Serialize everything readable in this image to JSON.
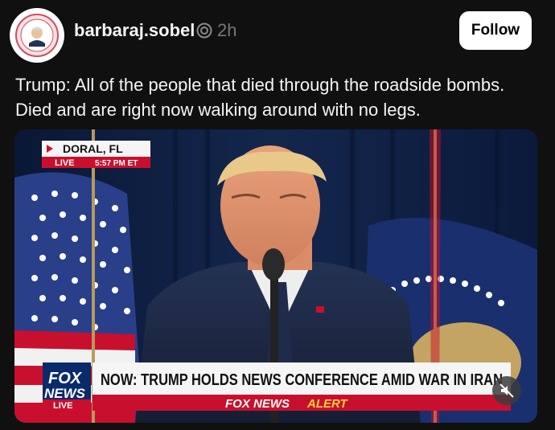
{
  "post": {
    "username": "barbaraj.sobel",
    "timestamp": "2h",
    "follow_label": "Follow",
    "text": "Trump: All of the people that died through the roadside bombs. Died and are right now walking around with no legs.",
    "avatar_text": "WILD LOVES JOE"
  },
  "video": {
    "location": "DORAL, FL",
    "live_label": "LIVE",
    "live_time": "5:57 PM ET",
    "headline": "NOW: TRUMP HOLDS NEWS CONFERENCE AMID WAR IN IRAN",
    "alert_prefix": "FOX NEWS",
    "alert_word": "ALERT",
    "logo_top": "FOX",
    "logo_bottom": "NEWS",
    "logo_live": "LIVE"
  },
  "icons": {
    "verified": "threads-verified-icon",
    "mute": "muted-speaker-icon"
  },
  "colors": {
    "background": "#101010",
    "follow_bg": "#ffffff",
    "fox_red": "#c8102e",
    "fox_blue": "#0b2a6b"
  }
}
